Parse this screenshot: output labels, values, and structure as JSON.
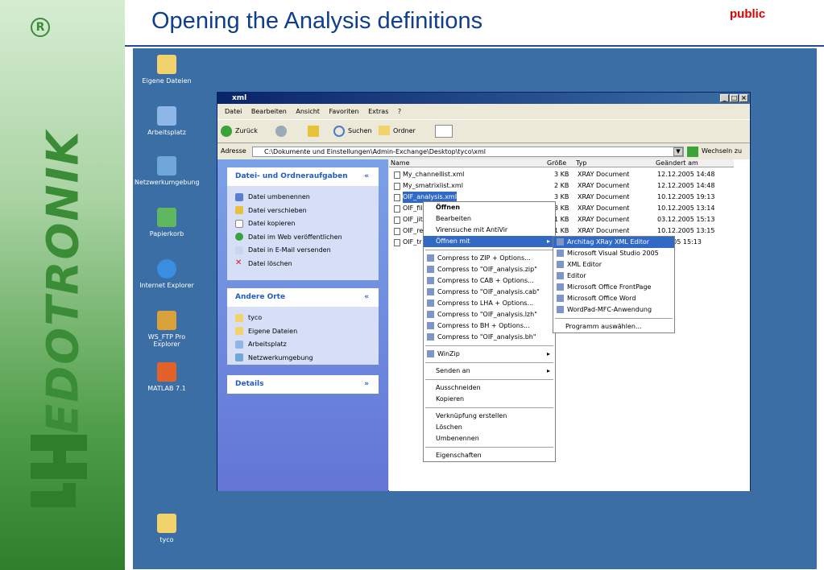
{
  "slide": {
    "title": "Opening the Analysis definitions",
    "tag": "public",
    "brand": "EDOTRONIK",
    "accent": "#0f3e8e",
    "tag_color": "#e00000"
  },
  "desktop_icons": [
    {
      "label": "Eigene Dateien",
      "icon": "folder-documents-icon"
    },
    {
      "label": "Arbeitsplatz",
      "icon": "computer-icon"
    },
    {
      "label": "Netzwerkumgebung",
      "icon": "network-icon"
    },
    {
      "label": "Papierkorb",
      "icon": "recycle-bin-icon"
    },
    {
      "label": "Internet Explorer",
      "icon": "internet-explorer-icon"
    },
    {
      "label": "WS_FTP Pro Explorer",
      "icon": "ftp-icon"
    },
    {
      "label": "MATLAB 7.1",
      "icon": "matlab-icon"
    },
    {
      "label": "tyco",
      "icon": "folder-icon"
    }
  ],
  "window": {
    "title": "xml",
    "menu": [
      "Datei",
      "Bearbeiten",
      "Ansicht",
      "Favoriten",
      "Extras",
      "?"
    ],
    "toolbar": {
      "back": "Zurück",
      "search": "Suchen",
      "folders": "Ordner"
    },
    "address_label": "Adresse",
    "address": "C:\\Dokumente und Einstellungen\\Admin-Exchange\\Desktop\\tyco\\xml",
    "go": "Wechseln zu"
  },
  "taskpane": {
    "file_tasks": {
      "title": "Datei- und Ordneraufgaben",
      "items": [
        "Datei umbenennen",
        "Datei verschieben",
        "Datei kopieren",
        "Datei im Web veröffentlichen",
        "Datei in E-Mail versenden",
        "Datei löschen"
      ]
    },
    "other_places": {
      "title": "Andere Orte",
      "items": [
        "tyco",
        "Eigene Dateien",
        "Arbeitsplatz",
        "Netzwerkumgebung"
      ]
    },
    "details": {
      "title": "Details"
    }
  },
  "files": {
    "columns": [
      "Name",
      "Größe",
      "Typ",
      "Geändert am"
    ],
    "rows": [
      {
        "name": "My_channellist.xml",
        "size": "3 KB",
        "type": "XRAY Document",
        "date": "12.12.2005 14:48"
      },
      {
        "name": "My_smatrixlist.xml",
        "size": "2 KB",
        "type": "XRAY Document",
        "date": "12.12.2005 14:48"
      },
      {
        "name": "OIF_analysis.xml",
        "size": "3 KB",
        "type": "XRAY Document",
        "date": "10.12.2005 19:13"
      },
      {
        "name": "OIF_fil",
        "size": "3 KB",
        "type": "XRAY Document",
        "date": "10.12.2005 13:14"
      },
      {
        "name": "OIF_jit",
        "size": "1 KB",
        "type": "XRAY Document",
        "date": "03.12.2005 15:13"
      },
      {
        "name": "OIF_re",
        "size": "1 KB",
        "type": "XRAY Document",
        "date": "10.12.2005 13:15"
      },
      {
        "name": "OIF_tr",
        "size": "",
        "type": "",
        "date": "2005 15:13"
      }
    ]
  },
  "context_menu": [
    {
      "label": "Öffnen",
      "bold": true
    },
    {
      "label": "Bearbeiten"
    },
    {
      "label": "Virensuche mit AntiVir"
    },
    {
      "label": "Öffnen mit",
      "submenu": true,
      "highlight": true
    },
    {
      "sep": true
    },
    {
      "label": "Compress to ZIP + Options...",
      "icon": "archive-icon"
    },
    {
      "label": "Compress to \"OIF_analysis.zip\"",
      "icon": "archive-icon"
    },
    {
      "label": "Compress to CAB + Options...",
      "icon": "archive-icon"
    },
    {
      "label": "Compress to \"OIF_analysis.cab\"",
      "icon": "archive-icon"
    },
    {
      "label": "Compress to LHA + Options...",
      "icon": "archive-icon"
    },
    {
      "label": "Compress to \"OIF_analysis.lzh\"",
      "icon": "archive-icon"
    },
    {
      "label": "Compress to BH + Options...",
      "icon": "archive-icon"
    },
    {
      "label": "Compress to \"OIF_analysis.bh\"",
      "icon": "archive-icon"
    },
    {
      "sep": true
    },
    {
      "label": "WinZip",
      "icon": "winzip-icon",
      "submenu": true
    },
    {
      "sep": true
    },
    {
      "label": "Senden an",
      "submenu": true
    },
    {
      "sep": true
    },
    {
      "label": "Ausschneiden"
    },
    {
      "label": "Kopieren"
    },
    {
      "sep": true
    },
    {
      "label": "Verknüpfung erstellen"
    },
    {
      "label": "Löschen"
    },
    {
      "label": "Umbenennen"
    },
    {
      "sep": true
    },
    {
      "label": "Eigenschaften"
    }
  ],
  "open_with_menu": [
    {
      "label": "Architag XRay XML Editor",
      "icon": "xray-icon",
      "highlight": true
    },
    {
      "label": "Microsoft Visual Studio 2005",
      "icon": "visual-studio-icon"
    },
    {
      "label": "XML Editor",
      "icon": "xml-editor-icon"
    },
    {
      "label": "Editor",
      "icon": "notepad-icon"
    },
    {
      "label": "Microsoft Office FrontPage",
      "icon": "frontpage-icon"
    },
    {
      "label": "Microsoft Office Word",
      "icon": "word-icon"
    },
    {
      "label": "WordPad-MFC-Anwendung",
      "icon": "wordpad-icon"
    },
    {
      "sep": true
    },
    {
      "label": "Programm auswählen..."
    }
  ]
}
